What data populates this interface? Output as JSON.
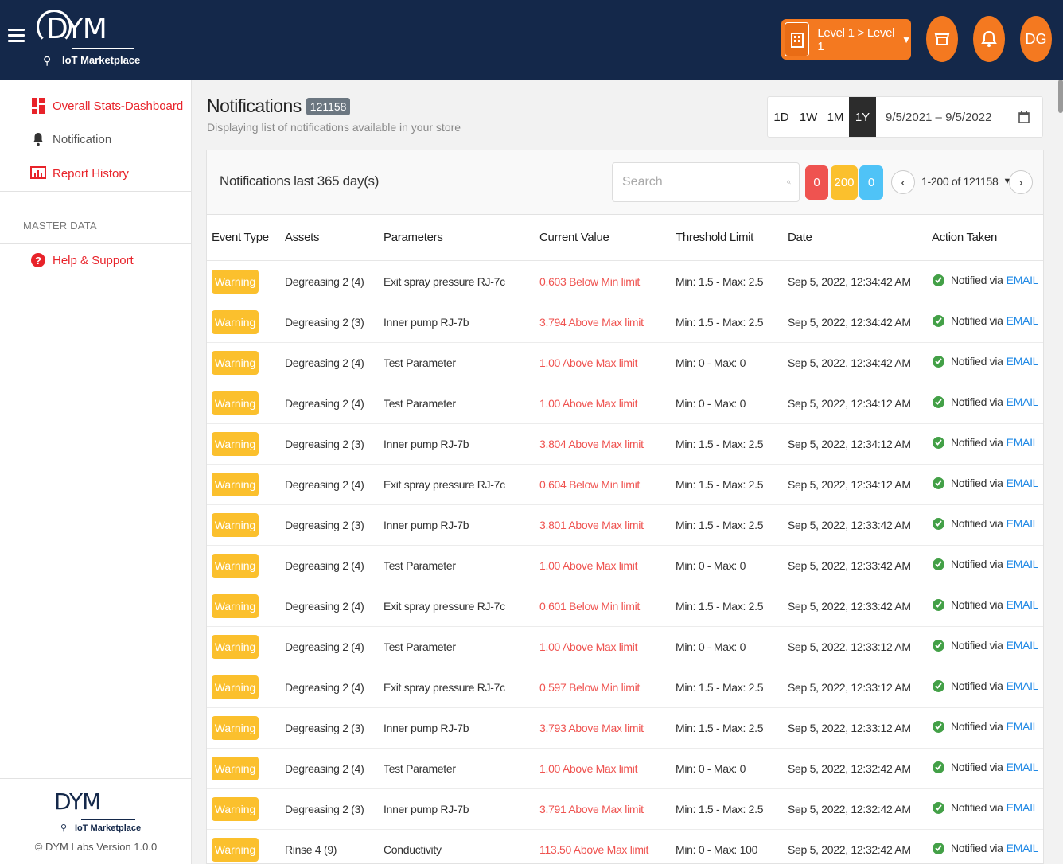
{
  "header": {
    "logo_text": "DYM",
    "logo_subtitle": "IoT Marketplace",
    "level_label": "Level 1 > Level 1",
    "avatar_initials": "DG"
  },
  "sidebar": {
    "items": [
      {
        "label": "Overall Stats-Dashboard"
      },
      {
        "label": "Notification"
      },
      {
        "label": "Report History"
      }
    ],
    "section_label": "MASTER DATA",
    "help_label": "Help & Support",
    "footer_logo_text": "DYM",
    "footer_logo_subtitle": "IoT Marketplace",
    "version": "© DYM Labs Version 1.0.0"
  },
  "page": {
    "title": "Notifications",
    "count": "121158",
    "subtitle": "Displaying list of notifications available in your store"
  },
  "range": {
    "buttons": [
      "1D",
      "1W",
      "1M",
      "1Y"
    ],
    "active": "1Y",
    "dates": "9/5/2021 – 9/5/2022"
  },
  "card": {
    "title": "Notifications last 365 day(s)",
    "search_placeholder": "Search",
    "counts": {
      "critical": "0",
      "warning": "200",
      "info": "0"
    },
    "pager": "1-200 of 121158"
  },
  "table": {
    "headers": [
      "Event Type",
      "Assets",
      "Parameters",
      "Current Value",
      "Threshold Limit",
      "Date",
      "Action Taken"
    ],
    "notified_prefix": "Notified via",
    "notified_channel": "EMAIL",
    "rows": [
      {
        "type": "Warning",
        "asset": "Degreasing 2 (4)",
        "param": "Exit spray pressure RJ-7c",
        "value": "0.603 Below Min limit",
        "limit": "Min: 1.5 - Max: 2.5",
        "date": "Sep 5, 2022, 12:34:42 AM"
      },
      {
        "type": "Warning",
        "asset": "Degreasing 2 (3)",
        "param": "Inner pump RJ-7b",
        "value": "3.794 Above Max limit",
        "limit": "Min: 1.5 - Max: 2.5",
        "date": "Sep 5, 2022, 12:34:42 AM"
      },
      {
        "type": "Warning",
        "asset": "Degreasing 2 (4)",
        "param": "Test Parameter",
        "value": "1.00 Above Max limit",
        "limit": "Min: 0 - Max: 0",
        "date": "Sep 5, 2022, 12:34:42 AM"
      },
      {
        "type": "Warning",
        "asset": "Degreasing 2 (4)",
        "param": "Test Parameter",
        "value": "1.00 Above Max limit",
        "limit": "Min: 0 - Max: 0",
        "date": "Sep 5, 2022, 12:34:12 AM"
      },
      {
        "type": "Warning",
        "asset": "Degreasing 2 (3)",
        "param": "Inner pump RJ-7b",
        "value": "3.804 Above Max limit",
        "limit": "Min: 1.5 - Max: 2.5",
        "date": "Sep 5, 2022, 12:34:12 AM"
      },
      {
        "type": "Warning",
        "asset": "Degreasing 2 (4)",
        "param": "Exit spray pressure RJ-7c",
        "value": "0.604 Below Min limit",
        "limit": "Min: 1.5 - Max: 2.5",
        "date": "Sep 5, 2022, 12:34:12 AM"
      },
      {
        "type": "Warning",
        "asset": "Degreasing 2 (3)",
        "param": "Inner pump RJ-7b",
        "value": "3.801 Above Max limit",
        "limit": "Min: 1.5 - Max: 2.5",
        "date": "Sep 5, 2022, 12:33:42 AM"
      },
      {
        "type": "Warning",
        "asset": "Degreasing 2 (4)",
        "param": "Test Parameter",
        "value": "1.00 Above Max limit",
        "limit": "Min: 0 - Max: 0",
        "date": "Sep 5, 2022, 12:33:42 AM"
      },
      {
        "type": "Warning",
        "asset": "Degreasing 2 (4)",
        "param": "Exit spray pressure RJ-7c",
        "value": "0.601 Below Min limit",
        "limit": "Min: 1.5 - Max: 2.5",
        "date": "Sep 5, 2022, 12:33:42 AM"
      },
      {
        "type": "Warning",
        "asset": "Degreasing 2 (4)",
        "param": "Test Parameter",
        "value": "1.00 Above Max limit",
        "limit": "Min: 0 - Max: 0",
        "date": "Sep 5, 2022, 12:33:12 AM"
      },
      {
        "type": "Warning",
        "asset": "Degreasing 2 (4)",
        "param": "Exit spray pressure RJ-7c",
        "value": "0.597 Below Min limit",
        "limit": "Min: 1.5 - Max: 2.5",
        "date": "Sep 5, 2022, 12:33:12 AM"
      },
      {
        "type": "Warning",
        "asset": "Degreasing 2 (3)",
        "param": "Inner pump RJ-7b",
        "value": "3.793 Above Max limit",
        "limit": "Min: 1.5 - Max: 2.5",
        "date": "Sep 5, 2022, 12:33:12 AM"
      },
      {
        "type": "Warning",
        "asset": "Degreasing 2 (4)",
        "param": "Test Parameter",
        "value": "1.00 Above Max limit",
        "limit": "Min: 0 - Max: 0",
        "date": "Sep 5, 2022, 12:32:42 AM"
      },
      {
        "type": "Warning",
        "asset": "Degreasing 2 (3)",
        "param": "Inner pump RJ-7b",
        "value": "3.791 Above Max limit",
        "limit": "Min: 1.5 - Max: 2.5",
        "date": "Sep 5, 2022, 12:32:42 AM"
      },
      {
        "type": "Warning",
        "asset": "Rinse 4 (9)",
        "param": "Conductivity",
        "value": "113.50 Above Max limit",
        "limit": "Min: 0 - Max: 100",
        "date": "Sep 5, 2022, 12:32:42 AM"
      }
    ]
  }
}
